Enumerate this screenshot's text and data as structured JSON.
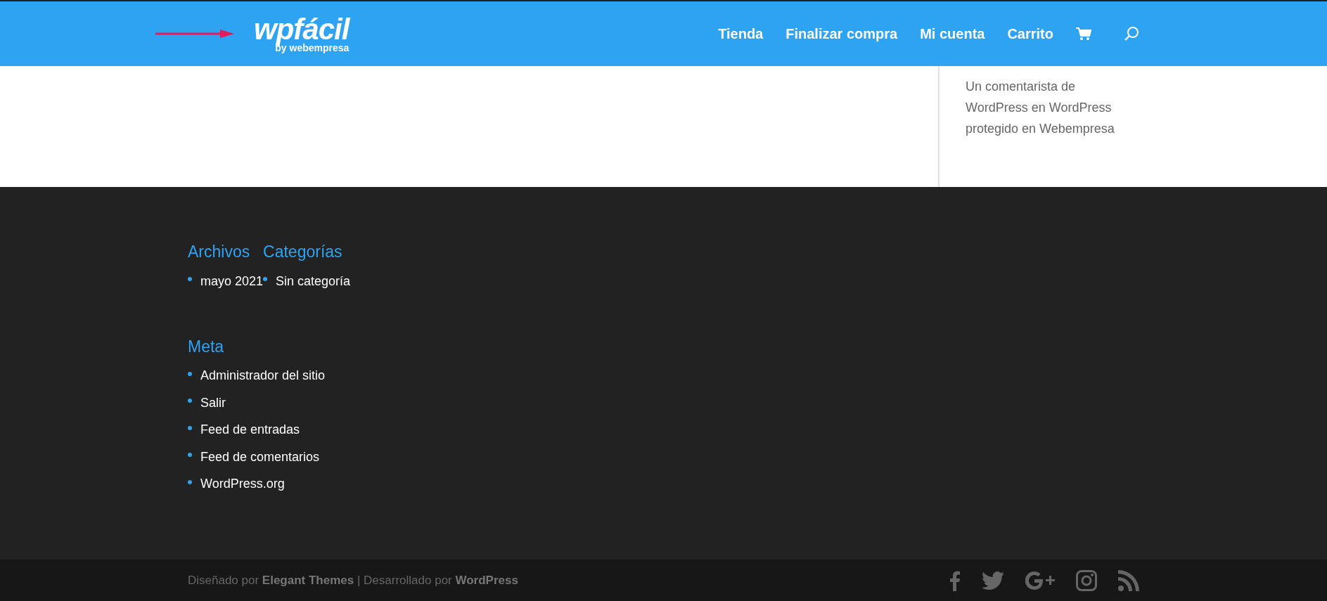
{
  "header": {
    "logo": {
      "name": "wpfácil",
      "tagline": "by webempresa"
    },
    "nav": [
      {
        "label": "Tienda"
      },
      {
        "label": "Finalizar compra"
      },
      {
        "label": "Mi cuenta"
      },
      {
        "label": "Carrito"
      }
    ]
  },
  "sidebar": {
    "text": "Un comentarista de WordPress en WordPress protegido en Webempresa"
  },
  "footer": {
    "widget_rows": [
      [
        {
          "title": "Archivos",
          "items": [
            "mayo 2021"
          ]
        },
        {
          "title": "Categorías",
          "items": [
            "Sin categoría"
          ]
        }
      ],
      [
        {
          "title": "Meta",
          "items": [
            "Administrador del sitio",
            "Salir",
            "Feed de entradas",
            "Feed de comentarios",
            "WordPress.org"
          ]
        }
      ]
    ]
  },
  "bottom_bar": {
    "credits": "Diseñado por **Elegant Themes** | Desarrollado por **WordPress**"
  }
}
